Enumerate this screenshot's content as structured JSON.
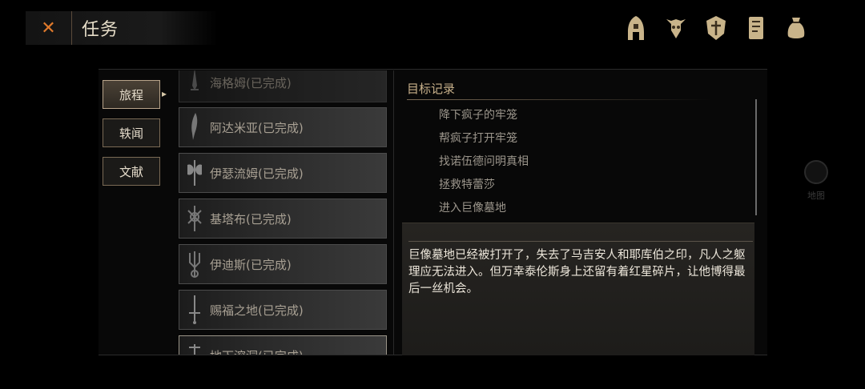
{
  "header": {
    "title": "任务",
    "close_icon": "close-icon"
  },
  "top_icons": [
    "helmet-icon",
    "horned-skull-icon",
    "shield-emblem-icon",
    "journal-icon",
    "pouch-icon"
  ],
  "tabs": [
    {
      "label": "旅程",
      "active": true
    },
    {
      "label": "轶闻",
      "active": false
    },
    {
      "label": "文献",
      "active": false
    }
  ],
  "quests": [
    {
      "label": "海格姆(已完成)",
      "icon": "dagger-icon"
    },
    {
      "label": "阿达米亚(已完成)",
      "icon": "blade-icon"
    },
    {
      "label": "伊瑟流姆(已完成)",
      "icon": "axe-icon"
    },
    {
      "label": "基塔布(已完成)",
      "icon": "cross-sigil-icon"
    },
    {
      "label": "伊迪斯(已完成)",
      "icon": "trident-icon"
    },
    {
      "label": "赐福之地(已完成)",
      "icon": "sword-icon"
    },
    {
      "label": "地下溶洞(已完成)",
      "icon": "staff-icon"
    }
  ],
  "detail": {
    "goal_title": "目标记录",
    "goals": [
      "降下疯子的牢笼",
      "帮疯子打开牢笼",
      "找诺伍德问明真相",
      "拯救特蕾莎",
      "进入巨像墓地"
    ],
    "description": "巨像墓地已经被打开了，失去了马吉安人和耶库伯之印，凡人之躯理应无法进入。但万幸泰伦斯身上还留有着红星碎片，让他博得最后一丝机会。"
  },
  "map": {
    "label": "地图"
  }
}
